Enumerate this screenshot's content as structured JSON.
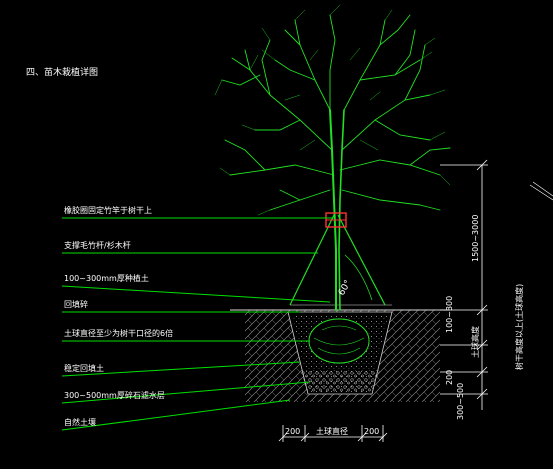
{
  "title": "四、苗木栽植详图",
  "labels": [
    "橡胶圈固定竹竿于树干上",
    "支撑毛竹杆/杉木杆",
    "100~300mm厚种植土",
    "回填碎",
    "土球直径至少为树干口径的6倍",
    "稳定回填土",
    "300~500mm厚碎石滤水层",
    "自然土壤"
  ],
  "angle_label": "60°",
  "right_dims": {
    "top": "1500~3000",
    "mid": "100~300",
    "soil_ball": "土球高度",
    "low": "200",
    "bottom": "300~500",
    "far_right": "树干高度以上(土球高度)"
  },
  "bottom_dims": [
    "200",
    "土球直径",
    "200"
  ],
  "colors": {
    "background": "#000000",
    "tree": "#22e022",
    "text": "#ffffff",
    "accent": "#ff3333"
  }
}
